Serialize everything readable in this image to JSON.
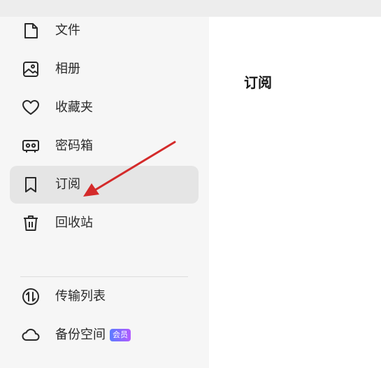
{
  "sidebar": {
    "items": [
      {
        "label": "文件",
        "icon": "file-icon"
      },
      {
        "label": "相册",
        "icon": "photo-album-icon"
      },
      {
        "label": "收藏夹",
        "icon": "heart-icon"
      },
      {
        "label": "密码箱",
        "icon": "safe-box-icon"
      },
      {
        "label": "订阅",
        "icon": "bookmark-icon",
        "active": true
      },
      {
        "label": "回收站",
        "icon": "trash-icon"
      }
    ],
    "bottom_items": [
      {
        "label": "传输列表",
        "icon": "transfer-icon"
      },
      {
        "label": "备份空间",
        "icon": "cloud-icon",
        "badge": "会员"
      }
    ]
  },
  "main": {
    "title": "订阅"
  },
  "colors": {
    "sidebar_bg": "#f6f6f6",
    "active_item_bg": "#e5e5e5",
    "annotation_arrow": "#d42a2a",
    "vip_badge_gradient_start": "#5b7cff",
    "vip_badge_gradient_end": "#b25bff"
  }
}
